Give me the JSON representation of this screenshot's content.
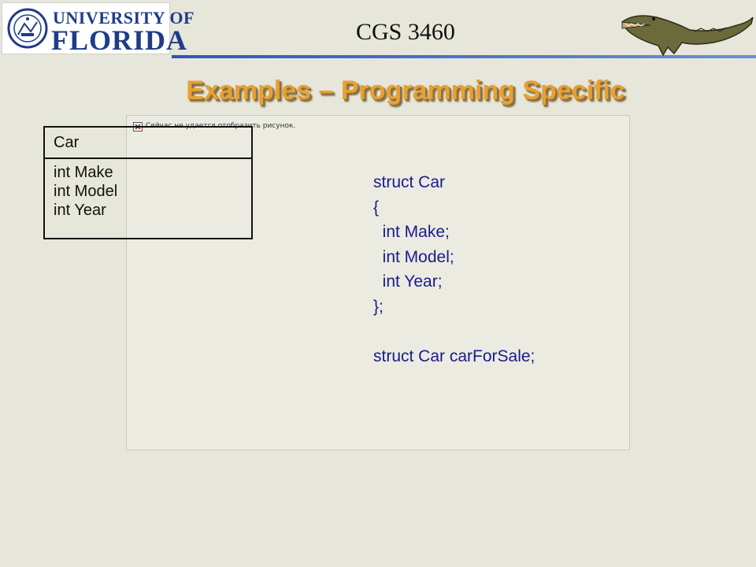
{
  "header": {
    "logo_line1": "UNIVERSITY OF",
    "logo_line2": "FLORIDA",
    "course_code": "CGS 3460"
  },
  "slide": {
    "title": "Examples – Programming Specific",
    "broken_image_text": "Сейчас не удается отобразить рисунок."
  },
  "uml_class": {
    "name": "Car",
    "attributes": [
      "int Make",
      "int Model",
      "int Year"
    ]
  },
  "code_lines": [
    "struct Car",
    "{",
    "  int Make;",
    "  int Model;",
    "  int Year;",
    "};",
    "",
    "struct Car carForSale;"
  ],
  "colors": {
    "background": "#e6e6da",
    "title": "#e8a030",
    "code": "#1a1a8c",
    "logo_blue": "#1f3c88"
  },
  "icons": {
    "seal": "university-seal-icon",
    "mascot": "alligator-icon",
    "broken_image": "broken-image-icon"
  }
}
